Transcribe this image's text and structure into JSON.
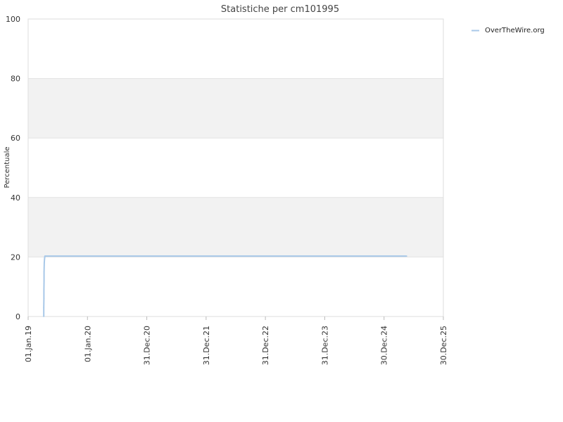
{
  "chart_data": {
    "type": "line",
    "title": "Statistiche per cm101995",
    "ylabel": "Percentuale",
    "xlabel": "",
    "ylim": [
      0,
      100
    ],
    "y_ticks": [
      "0",
      "20",
      "40",
      "60",
      "80",
      "100"
    ],
    "x_ticks": [
      {
        "label": "01.Jan.19",
        "date": "2019-01-01"
      },
      {
        "label": "01.Jan.20",
        "date": "2020-01-01"
      },
      {
        "label": "31.Dec.20",
        "date": "2020-12-31"
      },
      {
        "label": "31.Dec.21",
        "date": "2021-12-31"
      },
      {
        "label": "31.Dec.22",
        "date": "2022-12-31"
      },
      {
        "label": "31.Dec.23",
        "date": "2023-12-31"
      },
      {
        "label": "30.Dec.24",
        "date": "2024-12-30"
      },
      {
        "label": "30.Dec.25",
        "date": "2025-12-30"
      }
    ],
    "grid": true,
    "alternate_bands": true,
    "band_color": "#f2f2f2",
    "legend_position": "top-right",
    "series": [
      {
        "name": "OverTheWire.org",
        "color": "#a8c8e8",
        "points": [
          {
            "x": "2019-04-07",
            "y": 0
          },
          {
            "x": "2019-04-07",
            "y": 3
          },
          {
            "x": "2019-04-08",
            "y": 6
          },
          {
            "x": "2019-04-08",
            "y": 9
          },
          {
            "x": "2019-04-09",
            "y": 12
          },
          {
            "x": "2019-04-09",
            "y": 15
          },
          {
            "x": "2019-04-10",
            "y": 18
          },
          {
            "x": "2019-04-12",
            "y": 19.4
          },
          {
            "x": "2019-04-14",
            "y": 20.3
          },
          {
            "x": "2025-05-18",
            "y": 20.3
          }
        ]
      }
    ]
  }
}
